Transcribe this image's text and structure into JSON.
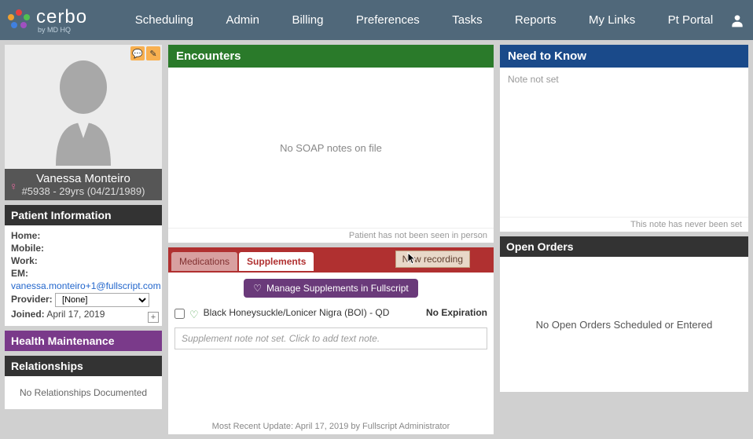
{
  "brand": {
    "name": "cerbo",
    "sub": "by MD HQ"
  },
  "nav": [
    "Scheduling",
    "Admin",
    "Billing",
    "Preferences",
    "Tasks",
    "Reports",
    "My Links",
    "Pt Portal"
  ],
  "patient": {
    "name": "Vanessa Monteiro",
    "id": "#5938",
    "age": "29yrs",
    "dob": "(04/21/1989)"
  },
  "info": {
    "title": "Patient Information",
    "home_label": "Home:",
    "mobile_label": "Mobile:",
    "work_label": "Work:",
    "em_label": "EM:",
    "email": "vanessa.monteiro+1@fullscript.com",
    "provider_label": "Provider:",
    "provider_value": "[None]",
    "joined_label": "Joined:",
    "joined_value": "April 17, 2019"
  },
  "health": {
    "title": "Health Maintenance"
  },
  "relationships": {
    "title": "Relationships",
    "empty": "No Relationships Documented"
  },
  "encounters": {
    "title": "Encounters",
    "empty": "No SOAP notes on file",
    "footer": "Patient has not been seen in person"
  },
  "ntk": {
    "title": "Need to Know",
    "empty": "Note not set",
    "footer": "This note has never been set"
  },
  "meds": {
    "tab_meds": "Medications",
    "tab_supp": "Supplements",
    "rec_badge": "New recording",
    "manage_btn": "Manage Supplements in Fullscript",
    "supplement": {
      "name": "Black Honeysuckle/Lonicer Nigra (BOI) - QD",
      "expiry": "No Expiration"
    },
    "note_placeholder": "Supplement note not set. Click to add text note.",
    "footer": "Most Recent Update: April 17, 2019 by Fullscript Administrator"
  },
  "orders": {
    "title": "Open Orders",
    "empty": "No Open Orders Scheduled or Entered"
  }
}
